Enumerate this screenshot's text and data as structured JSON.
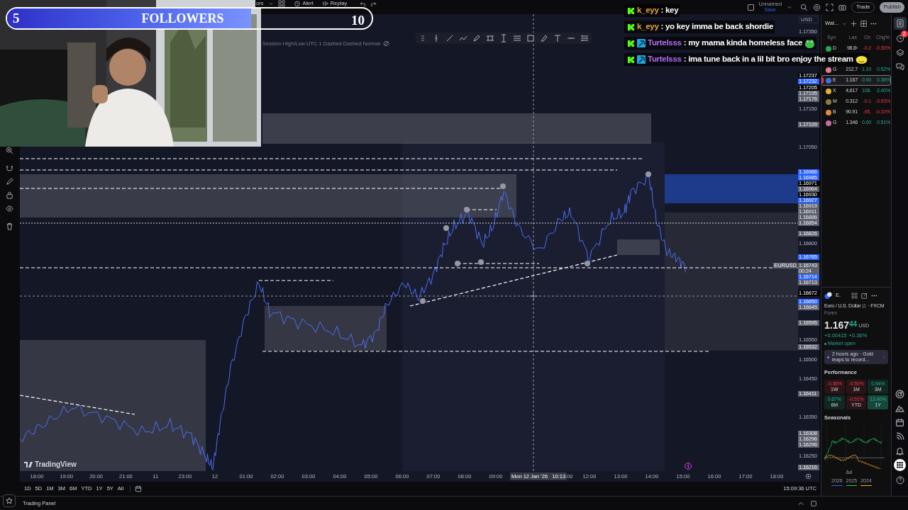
{
  "stream_overlay": {
    "goal": {
      "current": "5",
      "label": "FOLLOWERS",
      "target": "10",
      "level": 0.67
    },
    "chat": [
      {
        "badges": [
          {
            "kind": "kick"
          }
        ],
        "user": "k_eyy",
        "color": "#f0a43a",
        "text": ": key"
      },
      {
        "badges": [
          {
            "kind": "kick"
          }
        ],
        "user": "k_eyy",
        "color": "#f0a43a",
        "text": ": yo key imma be back shordie"
      },
      {
        "badges": [
          {
            "kind": "kick"
          },
          {
            "kind": "pickaxe"
          }
        ],
        "user": "Turtelsss",
        "color": "#b16cf0",
        "text": ": my mama kinda homeless face",
        "emote": {
          "kind": "frog"
        }
      },
      {
        "badges": [
          {
            "kind": "kick"
          },
          {
            "kind": "pickaxe"
          }
        ],
        "user": "Turtelsss",
        "color": "#b16cf0",
        "text": ": ima tune back in a lil bit bro enjoy the stream",
        "emote": {
          "kind": "blob"
        }
      }
    ]
  },
  "top_toolbar": {
    "indicators": "ors",
    "alert": "Alert",
    "replay": "Replay",
    "layout_checked": false,
    "layout_name": "Unnamed",
    "save": "Save",
    "trade": "Trade",
    "publish": "Publish"
  },
  "chart": {
    "legend": "Session High/Low UTC 1 Dashed Dashed Normal",
    "watermark": "TradingView",
    "currency": "USD",
    "price_labels": [
      {
        "text": "1.17350",
        "kind": "plain"
      },
      {
        "text": "1.17237",
        "kind": "black"
      },
      {
        "text": "1.17232",
        "kind": "blue"
      },
      {
        "text": "1.17205",
        "kind": "black"
      },
      {
        "text": "1.17195",
        "kind": "grey"
      },
      {
        "text": "1.17176",
        "kind": "grey"
      },
      {
        "text": "1.17150",
        "kind": "plain"
      },
      {
        "text": "1.17109",
        "kind": "grey"
      },
      {
        "text": "1.17050",
        "kind": "plain"
      },
      {
        "text": "1.16986",
        "kind": "blue"
      },
      {
        "text": "1.16985",
        "kind": "blue"
      },
      {
        "text": "1.16971",
        "kind": "black"
      },
      {
        "text": "1.16964",
        "kind": "grey"
      },
      {
        "text": "1.16930",
        "kind": "black"
      },
      {
        "text": "1.16927",
        "kind": "blue"
      },
      {
        "text": "1.16919",
        "kind": "grey"
      },
      {
        "text": "1.16911",
        "kind": "grey"
      },
      {
        "text": "1.16886",
        "kind": "grey"
      },
      {
        "text": "1.16854",
        "kind": "grey"
      },
      {
        "text": "1.16826",
        "kind": "grey"
      },
      {
        "text": "1.16800",
        "kind": "plain"
      },
      {
        "text": "1.16765",
        "kind": "blue"
      },
      {
        "text": "1.16743",
        "kind": "grey",
        "countdown": "00:24",
        "tag": "EURUSD"
      },
      {
        "text": "1.16714",
        "kind": "blue"
      },
      {
        "text": "1.16713",
        "kind": "grey"
      },
      {
        "text": "1.16672",
        "kind": "black"
      },
      {
        "text": "1.16650",
        "kind": "blue"
      },
      {
        "text": "1.16645",
        "kind": "grey"
      },
      {
        "text": "1.16595",
        "kind": "grey"
      },
      {
        "text": "1.16550",
        "kind": "plain"
      },
      {
        "text": "1.16532",
        "kind": "grey"
      },
      {
        "text": "1.16500",
        "kind": "plain"
      },
      {
        "text": "1.16450",
        "kind": "plain"
      },
      {
        "text": "1.16411",
        "kind": "grey"
      },
      {
        "text": "1.16350",
        "kind": "plain"
      },
      {
        "text": "1.16308",
        "kind": "grey"
      },
      {
        "text": "1.16296",
        "kind": "grey"
      },
      {
        "text": "1.16296",
        "kind": "grey"
      },
      {
        "text": "1.16250",
        "kind": "plain"
      },
      {
        "text": "1.16216",
        "kind": "grey"
      }
    ],
    "time_labels": [
      {
        "text": "18:00",
        "kind": "tick"
      },
      {
        "text": "19:00",
        "kind": "tick"
      },
      {
        "text": "20:00",
        "kind": "tick"
      },
      {
        "text": "21:00",
        "kind": "tick"
      },
      {
        "text": "11",
        "kind": "tick"
      },
      {
        "text": "23:00",
        "kind": "tick"
      },
      {
        "text": "12",
        "kind": "tick"
      },
      {
        "text": "01:00",
        "kind": "tick"
      },
      {
        "text": "02:00",
        "kind": "tick"
      },
      {
        "text": "03:00",
        "kind": "tick"
      },
      {
        "text": "04:00",
        "kind": "tick"
      },
      {
        "text": "05:00",
        "kind": "tick"
      },
      {
        "text": "06:00",
        "kind": "tick"
      },
      {
        "text": "07:00",
        "kind": "tick"
      },
      {
        "text": "08:00",
        "kind": "tick"
      },
      {
        "text": "09:00",
        "kind": "tick"
      },
      {
        "text": "Mon 12 Jan '26   10:13",
        "kind": "crosshair"
      },
      {
        "text": "00",
        "kind": "partial"
      },
      {
        "text": "12:00",
        "kind": "tick"
      },
      {
        "text": "13:00",
        "kind": "tick"
      },
      {
        "text": "14:00",
        "kind": "tick"
      },
      {
        "text": "15:00",
        "kind": "tick"
      },
      {
        "text": "16:00",
        "kind": "tick"
      },
      {
        "text": "17:00",
        "kind": "tick"
      },
      {
        "text": "18:00",
        "kind": "tick"
      }
    ]
  },
  "range_buttons": [
    "1D",
    "5D",
    "1M",
    "3M",
    "6M",
    "YTD",
    "1Y",
    "5Y",
    "All"
  ],
  "clock": "15:09:36 UTC",
  "trading_panel": "Trading Panel",
  "watchlist": {
    "title": "Wat...",
    "columns": [
      "Syn",
      "Las",
      "Ch",
      "Chg%"
    ],
    "rows": [
      {
        "symbol": "D",
        "last": "98.8‹",
        "change": "-0.2",
        "change_pct": "-0.30%",
        "negative": true,
        "color": "#26a65b",
        "selected": false
      },
      {
        "symbol": "G",
        "last": "212.7",
        "change": "1.10",
        "change_pct": "0.52%",
        "negative": false,
        "color": "#e07a9a",
        "selected": false
      },
      {
        "symbol": "E",
        "last": "1.167",
        "change": "0.00",
        "change_pct": "0.36%",
        "negative": false,
        "color": "#3f6ee0",
        "selected": true
      },
      {
        "symbol": "X",
        "last": "4,617",
        "change": "108.",
        "change_pct": "2.40%",
        "negative": false,
        "color": "#e0b030",
        "selected": false
      },
      {
        "symbol": "M",
        "last": "0.312",
        "change": "-0.1",
        "change_pct": "-3.93%",
        "negative": true,
        "color": "#8a7a40",
        "selected": false
      },
      {
        "symbol": "B",
        "last": "90.91",
        "change": "-95.",
        "change_pct": "-0.10%",
        "negative": true,
        "color": "#e08a3a",
        "selected": false
      },
      {
        "symbol": "G",
        "last": "1.346",
        "change": "0.00",
        "change_pct": "0.51%",
        "negative": false,
        "color": "#c070a0",
        "selected": false
      }
    ]
  },
  "alerts_badge": "2",
  "symbol": {
    "ticker": "E.",
    "name": "Euro / U.S. Dollar",
    "exchange": "· FXCM",
    "type": "Forex",
    "price_main": "1.167",
    "price_tail": "44",
    "currency": "USD",
    "change": "+0.00415",
    "change_pct": "+0.36%",
    "market_status": "Market open",
    "news": "2 hours ago · Gold leaps to record...",
    "performance_title": "Performance",
    "performance": [
      {
        "value": "-0.36%",
        "period": "1W",
        "negative": true,
        "highlighted": false
      },
      {
        "value": "-0.50%",
        "period": "1M",
        "negative": true,
        "highlighted": false
      },
      {
        "value": "0.94%",
        "period": "3M",
        "negative": false,
        "highlighted": false
      },
      {
        "value": "0.67%",
        "period": "6M",
        "negative": false,
        "highlighted": false
      },
      {
        "value": "-0.51%",
        "period": "YTD",
        "negative": true,
        "highlighted": false
      },
      {
        "value": "13.40%",
        "period": "1Y",
        "negative": false,
        "highlighted": true
      }
    ],
    "seasonals_title": "Seasonals",
    "seasonals_month": "Jul",
    "seasonals_legend": [
      "2026",
      "2025",
      "2024"
    ]
  }
}
